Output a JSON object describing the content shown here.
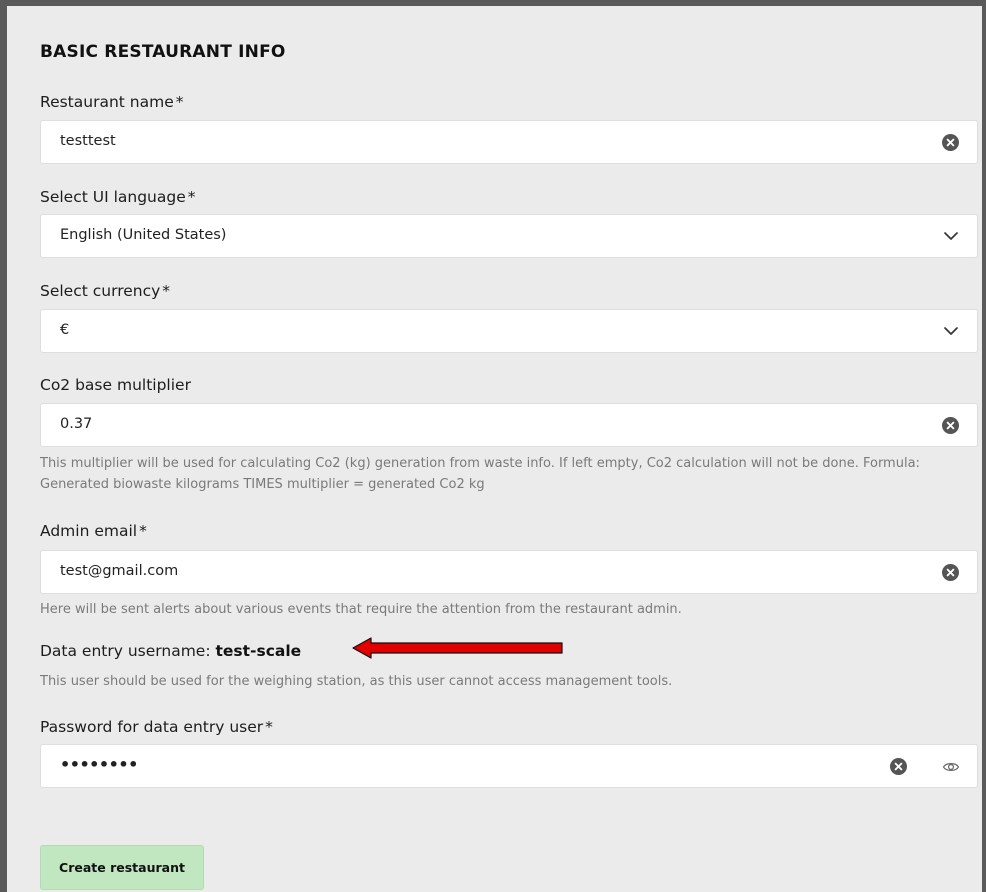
{
  "section": {
    "title": "BASIC RESTAURANT INFO"
  },
  "fields": {
    "restaurant_name": {
      "label": "Restaurant name",
      "required": "*",
      "value": "testtest"
    },
    "ui_language": {
      "label": "Select UI language",
      "required": "*",
      "value": "English (United States)"
    },
    "currency": {
      "label": "Select currency",
      "required": "*",
      "value": "€"
    },
    "co2_multiplier": {
      "label": "Co2 base multiplier",
      "value": "0.37",
      "help": "This multiplier will be used for calculating Co2 (kg) generation from waste info. If left empty, Co2 calculation will not be done. Formula: Generated biowaste kilograms TIMES multiplier = generated Co2 kg"
    },
    "admin_email": {
      "label": "Admin email",
      "required": "*",
      "value": "test@gmail.com",
      "help": "Here will be sent alerts about various events that require the attention from the restaurant admin."
    },
    "data_entry": {
      "label": "Data entry username:",
      "username": "test-scale",
      "help": "This user should be used for the weighing station, as this user cannot access management tools."
    },
    "password": {
      "label": "Password for data entry user",
      "required": "*",
      "value": "••••••••"
    }
  },
  "actions": {
    "create_label": "Create restaurant"
  },
  "colors": {
    "button_bg": "#c0e7bf",
    "arrow": "#e00000",
    "frame": "#5a5a5a"
  },
  "icons": {
    "clear": "clear-x-circle-icon",
    "dropdown": "chevron-down-icon",
    "reveal": "eye-icon",
    "annotation": "red-arrow-left"
  }
}
